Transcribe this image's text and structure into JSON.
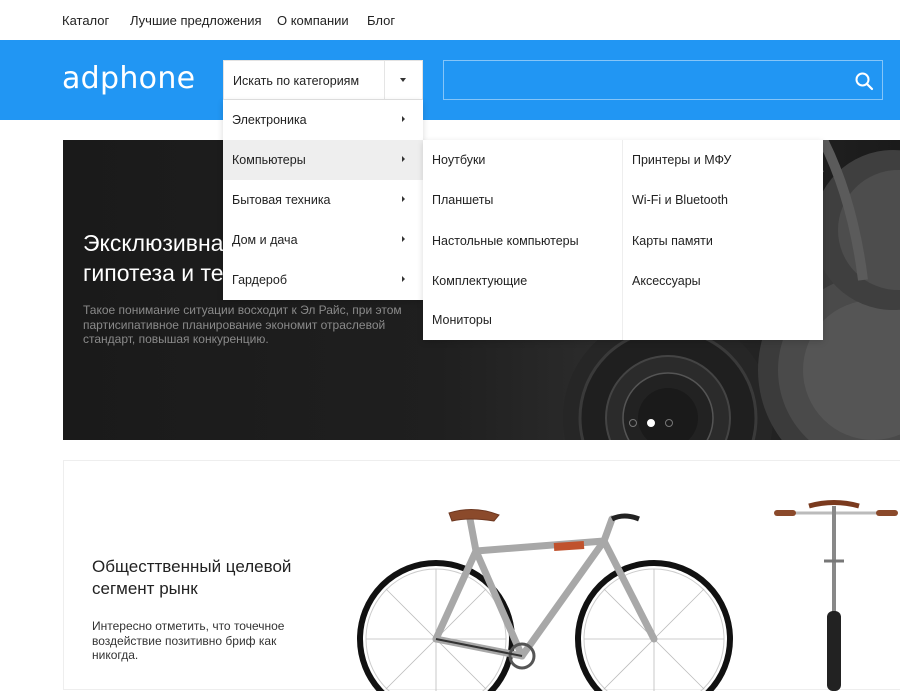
{
  "topnav": {
    "items": [
      {
        "label": "Каталог"
      },
      {
        "label": "Лучшие предложения"
      },
      {
        "label": "О компании"
      },
      {
        "label": "Блог"
      }
    ]
  },
  "header": {
    "logo": "adphone",
    "category_select": "Искать по категориям",
    "search": {
      "value": "",
      "placeholder": ""
    },
    "accent_color": "#2196f3"
  },
  "category_menu": {
    "items": [
      {
        "label": "Электроника"
      },
      {
        "label": "Компьютеры",
        "active": true
      },
      {
        "label": "Бытовая техника"
      },
      {
        "label": "Дом и дача"
      },
      {
        "label": "Гардероб"
      }
    ]
  },
  "submenu": {
    "col1": [
      "Ноутбуки",
      "Планшеты",
      "Настольные компьютеры",
      "Комплектующие",
      "Мониторы"
    ],
    "col2": [
      "Принтеры и МФУ",
      "Wi-Fi и Bluetooth",
      "Карты памяти",
      "Аксессуары"
    ]
  },
  "hero": {
    "title": "Эксклюзивная\nгипотеза и техника",
    "text": "Такое понимание ситуации восходит к Эл Райс, при этом партисипативное планирование экономит отраслевой стандарт, повышая конкуренцию.",
    "slides": 3,
    "active_slide": 2
  },
  "promo": {
    "title": "Общесттвенный целевой сегмент рынк",
    "text": "Интересно отметить, что точечное воздействие позитивно бриф как никогда."
  }
}
